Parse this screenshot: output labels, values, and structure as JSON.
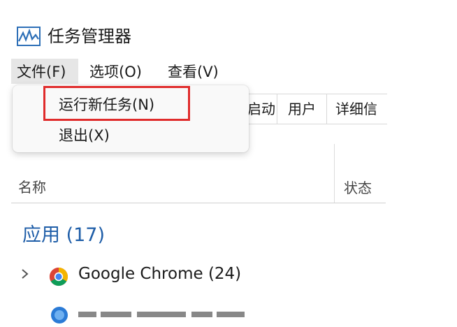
{
  "window": {
    "title": "任务管理器"
  },
  "menubar": {
    "file": "文件(F)",
    "options": "选项(O)",
    "view": "查看(V)"
  },
  "file_menu": {
    "items": [
      "运行新任务(N)",
      "退出(X)"
    ]
  },
  "tabs": [
    "启动",
    "用户",
    "详细信"
  ],
  "columns": {
    "name": "名称",
    "status": "状态"
  },
  "groups": {
    "apps": "应用 (17)"
  },
  "rows": [
    {
      "name": "Google Chrome (24)",
      "icon": "chrome-icon"
    }
  ],
  "colors": {
    "accent": "#1f5ea8",
    "highlight": "#e02b2b"
  }
}
